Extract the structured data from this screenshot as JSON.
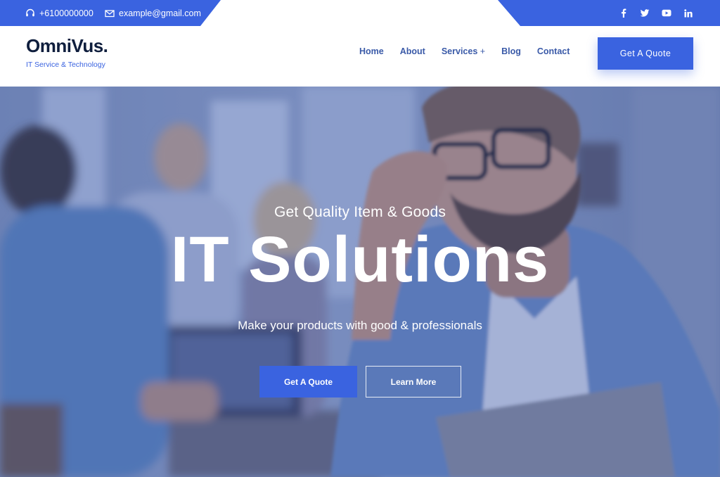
{
  "colors": {
    "accent": "#3a63e0",
    "dark": "#0f1e3d",
    "nav_text": "#3a5aa8"
  },
  "topbar": {
    "phone": "+6100000000",
    "phone_icon": "headset-icon",
    "email": "example@gmail.com",
    "email_icon": "envelope-icon",
    "social": [
      "facebook-icon",
      "twitter-icon",
      "youtube-icon",
      "linkedin-icon"
    ]
  },
  "header": {
    "logo": "OmniVus.",
    "tagline": "IT Service & Technology",
    "nav": {
      "home": "Home",
      "about": "About",
      "services": "Services",
      "services_plus": "+",
      "blog": "Blog",
      "contact": "Contact"
    },
    "cta": "Get A Quote"
  },
  "hero": {
    "kicker": "Get Quality Item & Goods",
    "title": "IT Solutions",
    "subtitle": "Make your products with good & professionals",
    "primary_button": "Get A Quote",
    "secondary_button": "Learn More"
  }
}
